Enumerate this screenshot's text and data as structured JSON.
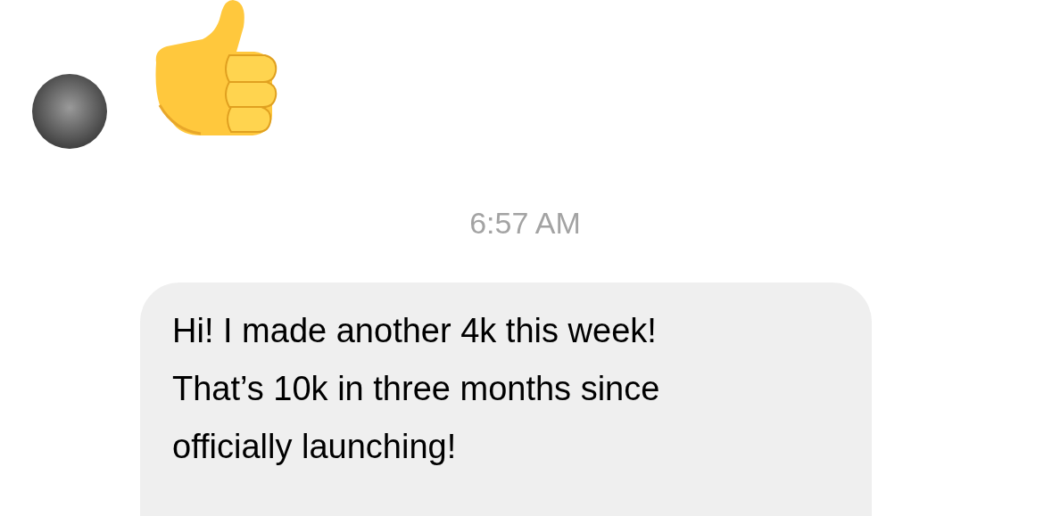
{
  "messages": [
    {
      "kind": "emoji",
      "outgoing": false
    },
    {
      "kind": "timestamp",
      "text": "6:57 AM"
    },
    {
      "kind": "bubble",
      "outgoing": false,
      "text": "Hi! I made another 4k this week!\nThat’s 10k in three months since\nofficially launching!"
    }
  ]
}
